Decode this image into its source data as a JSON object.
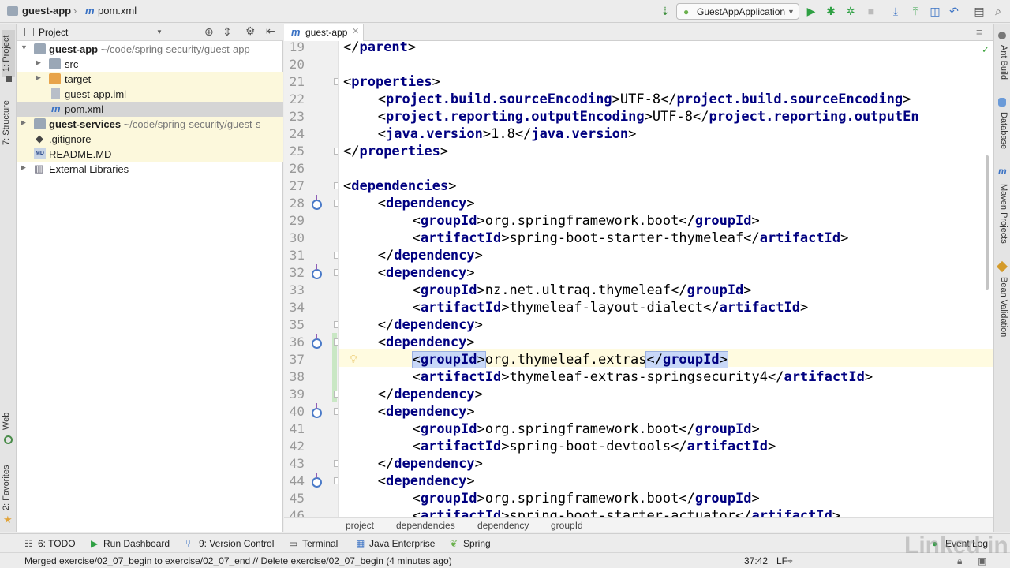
{
  "navbar": {
    "project_name": "guest-app",
    "file_name": "pom.xml",
    "run_config": "GuestAppApplication"
  },
  "left_stripe": {
    "project_tab": "1: Project",
    "structure_tab": "7: Structure",
    "web_tab": "Web",
    "favorites_tab": "2: Favorites"
  },
  "right_stripe": {
    "ant_build": "Ant Build",
    "database": "Database",
    "maven_projects": "Maven Projects",
    "bean_validation": "Bean Validation"
  },
  "project_panel": {
    "title": "Project",
    "tree": [
      {
        "label": "guest-app",
        "path": "~/code/spring-security/guest-app",
        "bold": true
      },
      {
        "label": "src"
      },
      {
        "label": "target"
      },
      {
        "label": "guest-app.iml"
      },
      {
        "label": "pom.xml"
      },
      {
        "label": "guest-services",
        "path": "~/code/spring-security/guest-s",
        "bold": true
      },
      {
        "label": ".gitignore"
      },
      {
        "label": "README.MD"
      },
      {
        "label": "External Libraries"
      }
    ]
  },
  "editor": {
    "tab_label": "guest-app",
    "line_numbers": [
      "19",
      "20",
      "21",
      "22",
      "23",
      "24",
      "25",
      "26",
      "27",
      "28",
      "29",
      "30",
      "31",
      "32",
      "33",
      "34",
      "35",
      "36",
      "37",
      "38",
      "39",
      "40",
      "41",
      "42",
      "43",
      "44",
      "45",
      "46"
    ],
    "lines": [
      {
        "indent": 1,
        "open": "",
        "text": "",
        "close": "parent"
      },
      {
        "indent": 0,
        "open": "",
        "text": "",
        "close": ""
      },
      {
        "indent": 1,
        "open": "properties",
        "text": "",
        "close": ""
      },
      {
        "indent": 2,
        "open": "project.build.sourceEncoding",
        "text": "UTF-8",
        "close": "project.build.sourceEncoding"
      },
      {
        "indent": 2,
        "open": "project.reporting.outputEncoding",
        "text": "UTF-8",
        "close": "project.reporting.outputEn"
      },
      {
        "indent": 2,
        "open": "java.version",
        "text": "1.8",
        "close": "java.version"
      },
      {
        "indent": 1,
        "open": "",
        "text": "",
        "close": "properties"
      },
      {
        "indent": 0,
        "open": "",
        "text": "",
        "close": ""
      },
      {
        "indent": 1,
        "open": "dependencies",
        "text": "",
        "close": ""
      },
      {
        "indent": 2,
        "open": "dependency",
        "text": "",
        "close": ""
      },
      {
        "indent": 3,
        "open": "groupId",
        "text": "org.springframework.boot",
        "close": "groupId"
      },
      {
        "indent": 3,
        "open": "artifactId",
        "text": "spring-boot-starter-thymeleaf",
        "close": "artifactId"
      },
      {
        "indent": 2,
        "open": "",
        "text": "",
        "close": "dependency"
      },
      {
        "indent": 2,
        "open": "dependency",
        "text": "",
        "close": ""
      },
      {
        "indent": 3,
        "open": "groupId",
        "text": "nz.net.ultraq.thymeleaf",
        "close": "groupId"
      },
      {
        "indent": 3,
        "open": "artifactId",
        "text": "thymeleaf-layout-dialect",
        "close": "artifactId"
      },
      {
        "indent": 2,
        "open": "",
        "text": "",
        "close": "dependency"
      },
      {
        "indent": 2,
        "open": "dependency",
        "text": "",
        "close": ""
      },
      {
        "indent": 3,
        "open": "groupId",
        "text": "org.thymeleaf.extras",
        "close": "groupId",
        "highlight": true
      },
      {
        "indent": 3,
        "open": "artifactId",
        "text": "thymeleaf-extras-springsecurity4",
        "close": "artifactId"
      },
      {
        "indent": 2,
        "open": "",
        "text": "",
        "close": "dependency"
      },
      {
        "indent": 2,
        "open": "dependency",
        "text": "",
        "close": ""
      },
      {
        "indent": 3,
        "open": "groupId",
        "text": "org.springframework.boot",
        "close": "groupId"
      },
      {
        "indent": 3,
        "open": "artifactId",
        "text": "spring-boot-devtools",
        "close": "artifactId"
      },
      {
        "indent": 2,
        "open": "",
        "text": "",
        "close": "dependency"
      },
      {
        "indent": 2,
        "open": "dependency",
        "text": "",
        "close": ""
      },
      {
        "indent": 3,
        "open": "groupId",
        "text": "org.springframework.boot",
        "close": "groupId"
      },
      {
        "indent": 3,
        "open": "artifactId",
        "text": "spring-boot-starter-actuator",
        "close": "artifactId"
      }
    ]
  },
  "breadcrumb": [
    "project",
    "dependencies",
    "dependency",
    "groupId"
  ],
  "bottom_tools": {
    "todo": "6: TODO",
    "run_dashboard": "Run Dashboard",
    "version_control": "9: Version Control",
    "terminal": "Terminal",
    "java_enterprise": "Java Enterprise",
    "spring": "Spring",
    "event_log": "Event Log"
  },
  "status": {
    "message": "Merged exercise/02_07_begin to exercise/02_07_end // Delete exercise/02_07_begin (4 minutes ago)",
    "position": "37:42",
    "line_sep": "LF÷"
  },
  "watermark": "Linked in",
  "colors": {
    "xml_tag": "#000080",
    "current_line": "#fffbe0",
    "run_green": "#2ea043"
  }
}
